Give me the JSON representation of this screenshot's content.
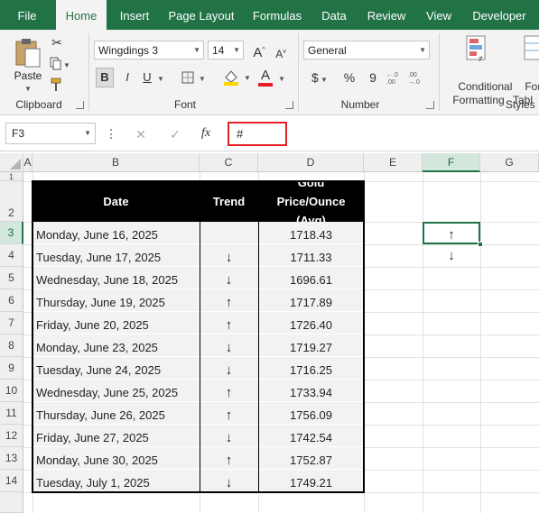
{
  "ribbon": {
    "tabs": [
      "File",
      "Home",
      "Insert",
      "Page Layout",
      "Formulas",
      "Data",
      "Review",
      "View",
      "Developer"
    ],
    "active_tab": "Home",
    "clipboard": {
      "paste_label": "Paste",
      "group_label": "Clipboard"
    },
    "font": {
      "font_name": "Wingdings 3",
      "font_size": "14",
      "group_label": "Font",
      "bold": "B",
      "italic": "I",
      "underline": "U",
      "grow": "A",
      "shrink": "A",
      "font_color": "A"
    },
    "number": {
      "format": "General",
      "currency": "$",
      "percent": "%",
      "comma": "9",
      "group_label": "Number"
    },
    "styles": {
      "conditional_formatting": "Conditional\nFormatting",
      "format_table": "Forma\nTabl",
      "group_label": "Styles"
    },
    "colors": {
      "accent": "#217346",
      "highlight": "#ffd700",
      "font_color_bar": "#e41f26"
    }
  },
  "formula_bar": {
    "name_box": "F3",
    "cancel": "✕",
    "enter": "✓",
    "fx": "fx",
    "formula": "#"
  },
  "grid": {
    "columns": [
      "A",
      "B",
      "C",
      "D",
      "E",
      "F",
      "G"
    ],
    "selected_column": "F",
    "rows": [
      "1",
      "2",
      "3",
      "4",
      "5",
      "6",
      "7",
      "8",
      "9",
      "10",
      "11",
      "12",
      "13",
      "14"
    ],
    "selected_row": "3",
    "header": {
      "date": "Date",
      "trend": "Trend",
      "price": "Gold Price/Ounce (Avg)"
    },
    "table": [
      {
        "date": "Monday, June 16, 2025",
        "trend": "",
        "price": "1718.43"
      },
      {
        "date": "Tuesday, June 17, 2025",
        "trend": "↓",
        "price": "1711.33"
      },
      {
        "date": "Wednesday, June 18, 2025",
        "trend": "↓",
        "price": "1696.61"
      },
      {
        "date": "Thursday, June 19, 2025",
        "trend": "↑",
        "price": "1717.89"
      },
      {
        "date": "Friday, June 20, 2025",
        "trend": "↑",
        "price": "1726.40"
      },
      {
        "date": "Monday, June 23, 2025",
        "trend": "↓",
        "price": "1719.27"
      },
      {
        "date": "Tuesday, June 24, 2025",
        "trend": "↓",
        "price": "1716.25"
      },
      {
        "date": "Wednesday, June 25, 2025",
        "trend": "↑",
        "price": "1733.94"
      },
      {
        "date": "Thursday, June 26, 2025",
        "trend": "↑",
        "price": "1756.09"
      },
      {
        "date": "Friday, June 27, 2025",
        "trend": "↓",
        "price": "1742.54"
      },
      {
        "date": "Monday, June 30, 2025",
        "trend": "↑",
        "price": "1752.87"
      },
      {
        "date": "Tuesday, July 1, 2025",
        "trend": "↓",
        "price": "1749.21"
      }
    ],
    "f_cells": {
      "f3": "↑",
      "f4": "↓"
    }
  }
}
